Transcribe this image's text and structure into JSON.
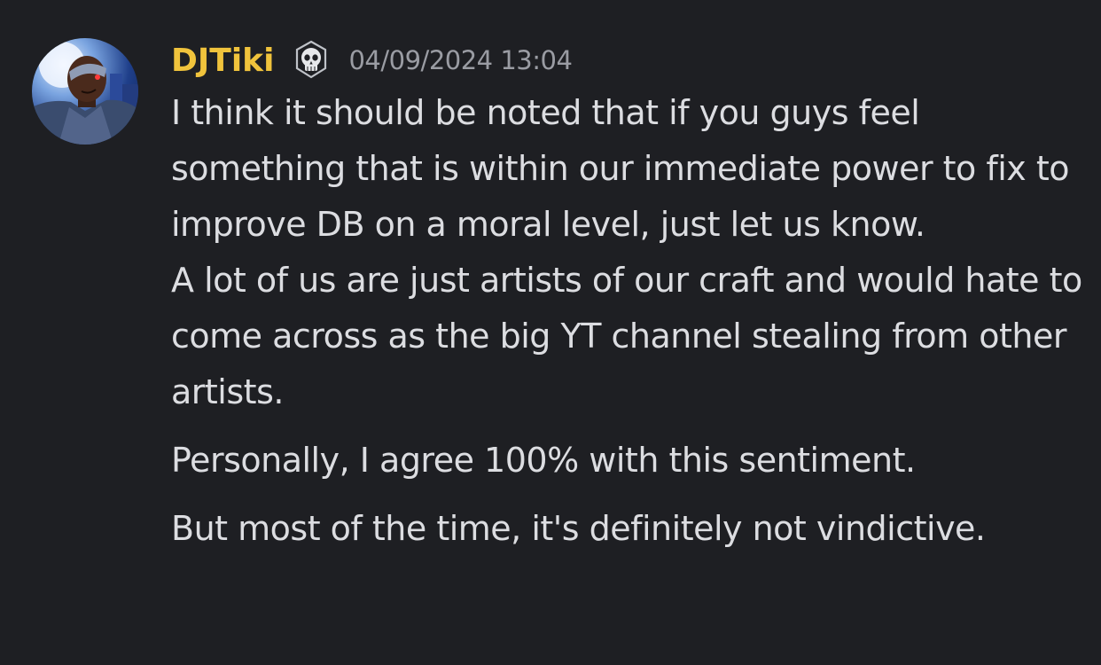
{
  "message": {
    "author": "DJTiki",
    "timestamp": "04/09/2024 13:04",
    "badge_icon": "skull-icon",
    "username_color": "#f0c33c",
    "paragraphs": [
      "I think it should be noted that if you guys feel something that is within our immediate power to fix to improve DB on a moral level, just let us know.",
      "A lot of us are just artists of our craft and would hate to come across as the big YT channel stealing from other artists.",
      "Personally, I agree 100% with this sentiment.",
      "But most of the time, it's definitely not vindictive."
    ]
  }
}
